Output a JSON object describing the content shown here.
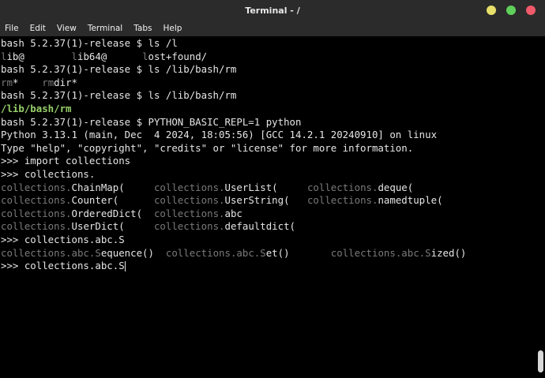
{
  "window": {
    "title": "Terminal - /",
    "controls": [
      {
        "name": "minimize-button",
        "color": "#e8df6a"
      },
      {
        "name": "maximize-button",
        "color": "#5fd05a"
      },
      {
        "name": "close-button",
        "color": "#f05a6a"
      }
    ]
  },
  "menu": [
    "File",
    "Edit",
    "View",
    "Terminal",
    "Tabs",
    "Help"
  ],
  "terminal": {
    "lines": [
      [
        {
          "t": "bash 5.2.37(1)-release $ ls /l"
        }
      ],
      [
        {
          "t": "l",
          "c": "dim"
        },
        {
          "t": "ib@        "
        },
        {
          "t": "l",
          "c": "dim"
        },
        {
          "t": "ib64@      "
        },
        {
          "t": "l",
          "c": "dim"
        },
        {
          "t": "ost+found/"
        }
      ],
      [
        {
          "t": "bash 5.2.37(1)-release $ ls /lib/bash/rm"
        }
      ],
      [
        {
          "t": "rm",
          "c": "dim"
        },
        {
          "t": "*    "
        },
        {
          "t": "rm",
          "c": "dim"
        },
        {
          "t": "dir*"
        }
      ],
      [
        {
          "t": "bash 5.2.37(1)-release $ ls /lib/bash/rm"
        }
      ],
      [
        {
          "t": "/lib/bash/rm",
          "c": "green"
        }
      ],
      [
        {
          "t": "bash 5.2.37(1)-release $ PYTHON_BASIC_REPL=1 python"
        }
      ],
      [
        {
          "t": "Python 3.13.1 (main, Dec  4 2024, 18:05:56) [GCC 14.2.1 20240910] on linux"
        }
      ],
      [
        {
          "t": "Type \"help\", \"copyright\", \"credits\" or \"license\" for more information."
        }
      ],
      [
        {
          "t": ">>> import collections"
        }
      ],
      [
        {
          "t": ">>> collections."
        }
      ],
      [
        {
          "t": "collections.",
          "c": "dim"
        },
        {
          "t": "ChainMap(     "
        },
        {
          "t": "collections.",
          "c": "dim"
        },
        {
          "t": "UserList(     "
        },
        {
          "t": "collections.",
          "c": "dim"
        },
        {
          "t": "deque("
        }
      ],
      [
        {
          "t": "collections.",
          "c": "dim"
        },
        {
          "t": "Counter(      "
        },
        {
          "t": "collections.",
          "c": "dim"
        },
        {
          "t": "UserString(   "
        },
        {
          "t": "collections.",
          "c": "dim"
        },
        {
          "t": "namedtuple("
        }
      ],
      [
        {
          "t": "collections.",
          "c": "dim"
        },
        {
          "t": "OrderedDict(  "
        },
        {
          "t": "collections.",
          "c": "dim"
        },
        {
          "t": "abc"
        }
      ],
      [
        {
          "t": "collections.",
          "c": "dim"
        },
        {
          "t": "UserDict(     "
        },
        {
          "t": "collections.",
          "c": "dim"
        },
        {
          "t": "defaultdict("
        }
      ],
      [
        {
          "t": ">>> collections.abc.S"
        }
      ],
      [
        {
          "t": "collections.abc.S",
          "c": "dim"
        },
        {
          "t": "equence()  "
        },
        {
          "t": "collections.abc.S",
          "c": "dim"
        },
        {
          "t": "et()       "
        },
        {
          "t": "collections.abc.S",
          "c": "dim"
        },
        {
          "t": "ized()"
        }
      ],
      [
        {
          "t": ">>> collections.abc.S"
        },
        {
          "cursor": true
        }
      ]
    ]
  }
}
